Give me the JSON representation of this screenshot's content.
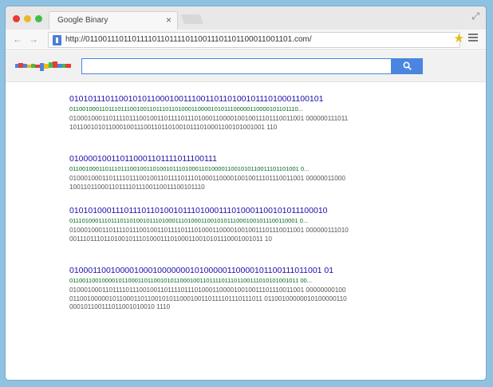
{
  "window": {
    "tab_title": "Google Binary",
    "tab_close": "×",
    "back_arrow": "←",
    "forward_arrow": "→",
    "url": "http://0110011101101111011011110110011101101100011001101.com/",
    "star": "★",
    "resize": "⤢"
  },
  "search": {
    "query": ""
  },
  "results": [
    {
      "title": "0101011101100101011000100111001101101001011101000110010​1",
      "url": "01100100011011101110010011011101101000110000101011100000110000101101110...",
      "snippet": "0100010001101111011100100110111101110100011000010010011101110011001 0000001110111011001010110001001110011011010010111010001100101001001 110"
    },
    {
      "title": "010000100110110001101111011100111",
      "url": "01100100011011101110010011010010111010001101000011001010110011101101001 0...",
      "snippet": "0100010001101111011100100110111101110100011000010010011101110011001 00000011000100110110001101111011100110011100101110"
    },
    {
      "title": "010101000111011101101001011101000111010001100101011100010",
      "url": "01110100011101110110100101110100011101000110010101110001001011100110001 0...",
      "snippet": "0100010001101111011100100110111101110100011000010010011101110011001 0000001110100011101110110100101110100011101000110010101110001001011 10"
    },
    {
      "title": "0100011001000010001000000010100000110000101100111011001 01",
      "url": "01100110010000101100011011001010110001001101111011101100111010101001011 00...",
      "snippet": "0100010001101111011100100110111101110100011000010010011101110011001 000000001000110010000010110001101100101011000100110111101110111011 01100100000010100000110000101100111011001010010 1110"
    }
  ],
  "colors": {
    "accent": "#4a85e0",
    "link": "#1a0dab",
    "url_green": "#006621",
    "star": "#f0b90b"
  }
}
